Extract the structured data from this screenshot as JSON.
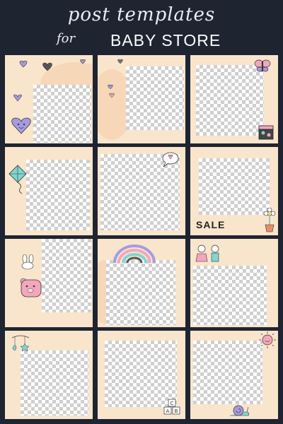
{
  "header": {
    "title_line1": "post templates",
    "title_line2": "for",
    "store_name": "BABY STORE"
  },
  "tiles": [
    {
      "deco": [
        "hearts-icon",
        "heart-face-icon"
      ]
    },
    {
      "deco": [
        "hearts-icon"
      ]
    },
    {
      "deco": [
        "butterfly-icon",
        "toy-block-icon"
      ]
    },
    {
      "deco": [
        "kite-icon"
      ]
    },
    {
      "deco": [
        "heart-speech-bubble-icon"
      ]
    },
    {
      "text": "SALE",
      "deco": [
        "flower-pot-icon"
      ]
    },
    {
      "deco": [
        "bunny-icon",
        "bear-icon"
      ]
    },
    {
      "deco": [
        "rainbow-icon"
      ]
    },
    {
      "deco": [
        "kids-icon"
      ]
    },
    {
      "deco": [
        "baby-mobile-icon"
      ]
    },
    {
      "deco": [
        "abc-blocks-icon"
      ]
    },
    {
      "deco": [
        "sun-icon",
        "snail-icon"
      ]
    }
  ],
  "colors": {
    "background": "#1f2431",
    "tile": "#f9e5cc",
    "accent_purple": "#a79be0",
    "accent_pink": "#f2a7bd",
    "accent_teal": "#7fd6d2"
  }
}
